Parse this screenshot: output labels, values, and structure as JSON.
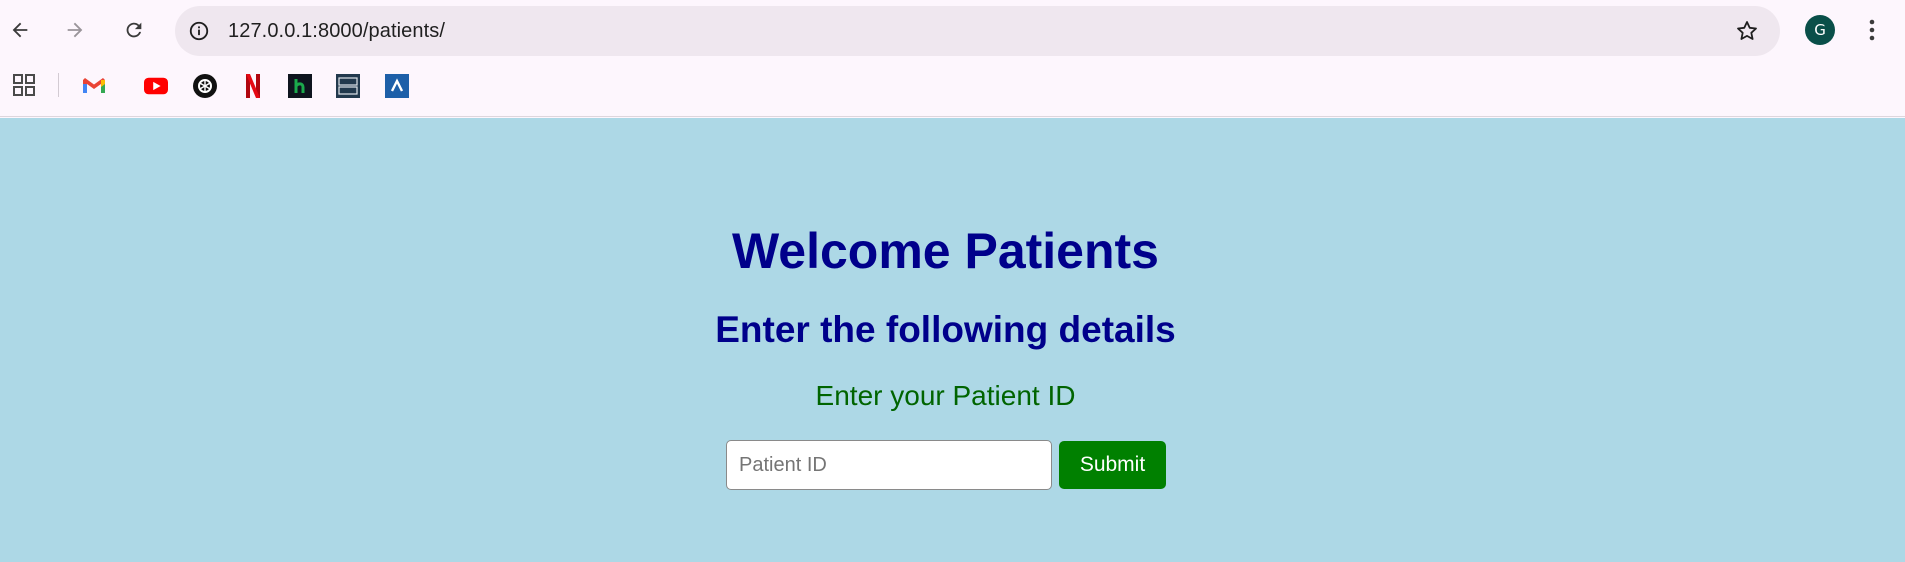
{
  "browser": {
    "url": "127.0.0.1:8000/patients/",
    "profile_initial": "G",
    "icons": {
      "back": "arrow-left-icon",
      "forward": "arrow-right-icon",
      "reload": "reload-icon",
      "site_info": "info-icon",
      "bookmark": "star-icon",
      "menu": "kebab-menu-icon"
    },
    "bookmarks": [
      {
        "name": "apps-grid-icon"
      },
      {
        "name": "gmail-icon"
      },
      {
        "name": "youtube-icon"
      },
      {
        "name": "openai-icon"
      },
      {
        "name": "netflix-icon"
      },
      {
        "name": "hackerrank-icon"
      },
      {
        "name": "leetcode-icon"
      },
      {
        "name": "aws-icon"
      }
    ]
  },
  "page": {
    "title": "Welcome Patients",
    "subtitle": "Enter the following details",
    "field_label": "Enter your Patient ID",
    "input": {
      "placeholder": "Patient ID",
      "value": ""
    },
    "submit_label": "Submit"
  },
  "colors": {
    "page_bg": "#add8e6",
    "heading": "#00008b",
    "label": "#006400",
    "submit_bg": "#008000",
    "avatar_bg": "#0a4f49"
  }
}
